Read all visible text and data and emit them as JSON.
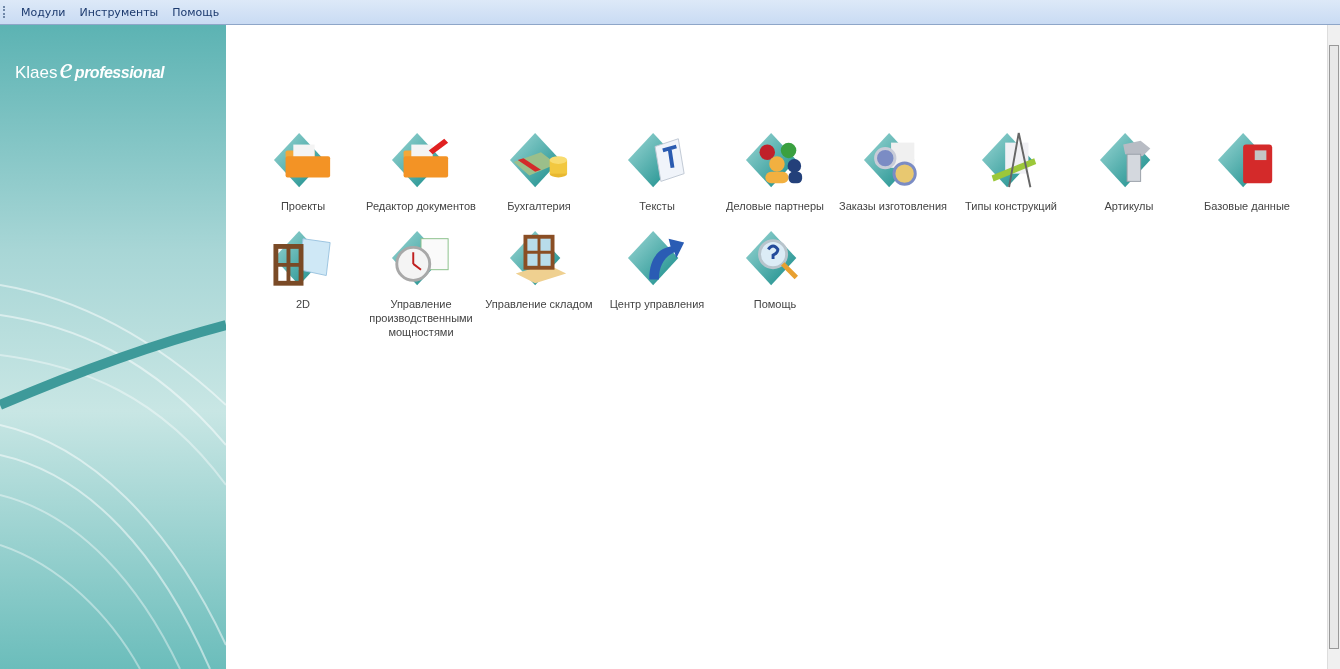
{
  "menu": [
    "Модули",
    "Инструменты",
    "Помощь"
  ],
  "logo": {
    "brand": "Klaes",
    "mark": "e",
    "suffix": "professional"
  },
  "modules": [
    {
      "label": "Проекты",
      "kind": "folder"
    },
    {
      "label": "Редактор документов",
      "kind": "document-editor"
    },
    {
      "label": "Бухгалтерия",
      "kind": "money"
    },
    {
      "label": "Тексты",
      "kind": "text"
    },
    {
      "label": "Деловые партнеры",
      "kind": "people"
    },
    {
      "label": "Заказы изготовления",
      "kind": "gears"
    },
    {
      "label": "Типы конструкций",
      "kind": "compass"
    },
    {
      "label": "Артикулы",
      "kind": "bolt"
    },
    {
      "label": "Базовые данные",
      "kind": "book"
    },
    {
      "label": "2D",
      "kind": "window"
    },
    {
      "label": "Управление производственными мощностями",
      "kind": "stopwatch"
    },
    {
      "label": "Управление складом",
      "kind": "pallet"
    },
    {
      "label": "Центр управления",
      "kind": "arrow"
    },
    {
      "label": "Помощь",
      "kind": "help"
    }
  ]
}
